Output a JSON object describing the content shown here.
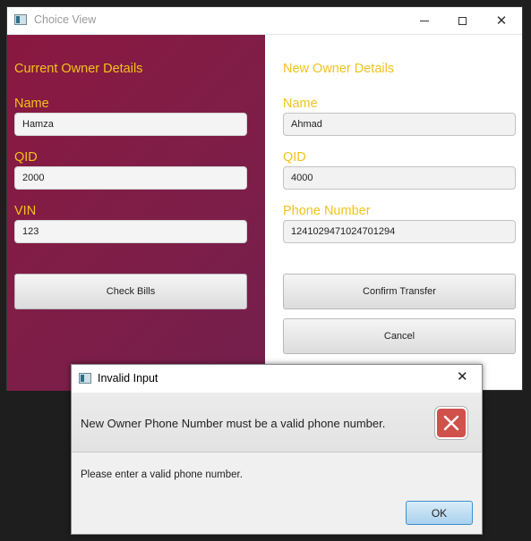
{
  "window": {
    "title": "Choice View",
    "minimize_icon": "minimize-icon",
    "maximize_icon": "maximize-icon",
    "close_glyph": "✕"
  },
  "current_owner": {
    "heading": "Current Owner Details",
    "name_label": "Name",
    "name_value": "Hamza",
    "qid_label": "QID",
    "qid_value": "2000",
    "vin_label": "VIN",
    "vin_value": "123",
    "check_bills_label": "Check Bills"
  },
  "new_owner": {
    "heading": "New Owner Details",
    "name_label": "Name",
    "name_value": "Ahmad",
    "qid_label": "QID",
    "qid_value": "4000",
    "phone_label": "Phone Number",
    "phone_value": "1241029471024701294",
    "confirm_label": "Confirm Transfer",
    "cancel_label": "Cancel"
  },
  "dialog": {
    "title": "Invalid Input",
    "close_glyph": "✕",
    "header_text": "New Owner Phone Number must be a valid phone number.",
    "content_text": "Please enter a valid phone number.",
    "ok_label": "OK",
    "icon": "error-icon"
  },
  "colors": {
    "accent_label": "#f3c21c",
    "left_pane": "#801d45",
    "error": "#d0504b"
  }
}
